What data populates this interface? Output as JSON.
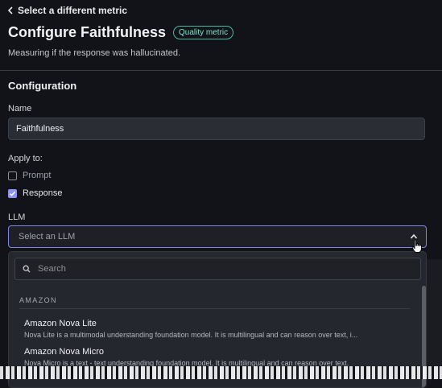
{
  "nav": {
    "back_label": "Select a different metric"
  },
  "header": {
    "title": "Configure Faithfulness",
    "badge": "Quality metric",
    "subtitle": "Measuring if the response was hallucinated."
  },
  "configuration": {
    "section_title": "Configuration",
    "name_label": "Name",
    "name_value": "Faithfulness",
    "apply_to_label": "Apply to:",
    "apply_options": [
      {
        "label": "Prompt",
        "checked": false
      },
      {
        "label": "Response",
        "checked": true
      }
    ],
    "llm_label": "LLM",
    "llm_placeholder": "Select an LLM"
  },
  "dropdown": {
    "search_placeholder": "Search",
    "group_label": "AMAZON",
    "options": [
      {
        "name": "Amazon Nova Lite",
        "description": "Nova Lite is a multimodal understanding foundation model. It is multilingual and can reason over text, i..."
      },
      {
        "name": "Amazon Nova Micro",
        "description": "Nova Micro is a text - text understanding foundation model. It is multilingual and can reason over text."
      }
    ]
  },
  "colors": {
    "accent": "#8e95f0",
    "badge": "#4ab9a7",
    "background": "#111318"
  }
}
